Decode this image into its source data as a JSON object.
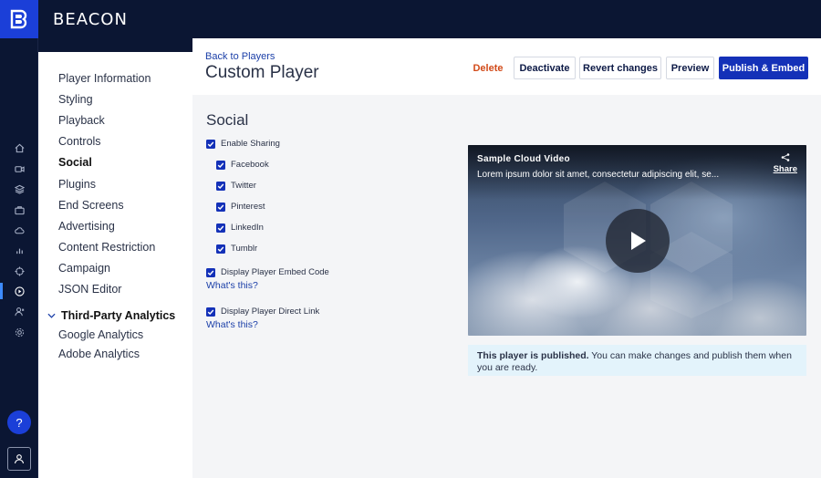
{
  "app": {
    "name": "BEACON"
  },
  "rail": {
    "icons": [
      "home-icon",
      "video-icon",
      "layers-icon",
      "briefcase-icon",
      "cloud-icon",
      "chart-icon",
      "target-icon",
      "play-circle-icon",
      "user-manage-icon",
      "settings-icon"
    ],
    "help_label": "?"
  },
  "nav": {
    "items": [
      {
        "label": "Player Information"
      },
      {
        "label": "Styling"
      },
      {
        "label": "Playback"
      },
      {
        "label": "Controls"
      },
      {
        "label": "Social"
      },
      {
        "label": "Plugins"
      },
      {
        "label": "End Screens"
      },
      {
        "label": "Advertising"
      },
      {
        "label": "Content Restriction"
      },
      {
        "label": "Campaign"
      },
      {
        "label": "JSON Editor"
      }
    ],
    "active": "Social",
    "group": {
      "label": "Third-Party Analytics",
      "items": [
        {
          "label": "Google Analytics"
        },
        {
          "label": "Adobe Analytics"
        }
      ]
    }
  },
  "header": {
    "back_link": "Back to Players",
    "title": "Custom Player",
    "buttons": {
      "delete": "Delete",
      "deactivate": "Deactivate",
      "revert": "Revert changes",
      "preview": "Preview",
      "publish": "Publish & Embed"
    }
  },
  "social": {
    "section_title": "Social",
    "enable_sharing": {
      "label": "Enable Sharing",
      "checked": true
    },
    "networks": [
      {
        "label": "Facebook",
        "checked": true
      },
      {
        "label": "Twitter",
        "checked": true
      },
      {
        "label": "Pinterest",
        "checked": true
      },
      {
        "label": "LinkedIn",
        "checked": true
      },
      {
        "label": "Tumblr",
        "checked": true
      }
    ],
    "embed_code": {
      "label": "Display Player Embed Code",
      "checked": true,
      "help": "What's this?"
    },
    "direct_link": {
      "label": "Display Player Direct Link",
      "checked": true,
      "help": "What's this?"
    }
  },
  "video": {
    "title": "Sample Cloud Video",
    "description": "Lorem ipsum dolor sit amet, consectetur adipiscing elit, se...",
    "share_label": "Share"
  },
  "notice": {
    "bold": "This player is published.",
    "text": " You can make changes and publish them when you are ready."
  },
  "colors": {
    "brand": "#1b3fd8",
    "primary_button": "#1431b8",
    "delete": "#d24b1a",
    "dark_bg": "#0b1633",
    "notice_bg": "#e3f3fb"
  }
}
